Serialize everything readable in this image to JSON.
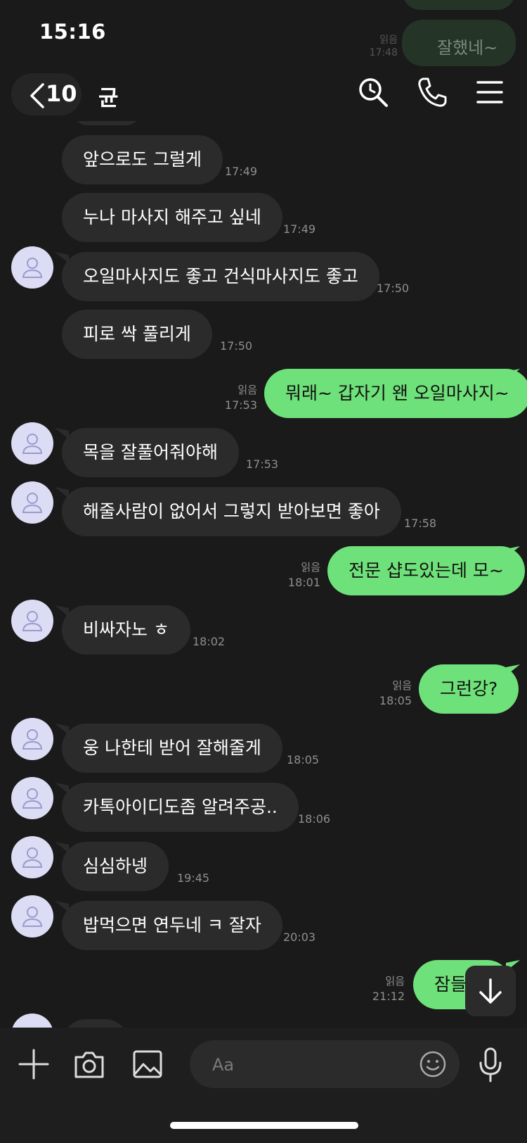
{
  "status_bar": {
    "time": "15:16"
  },
  "faded_top": {
    "read": "읽음",
    "time": "17:48",
    "text": "잘했네~"
  },
  "header": {
    "unread_count": "10",
    "title": "균"
  },
  "messages": [
    {
      "text": "앞으로도 그럴게",
      "time": "17:49"
    },
    {
      "text": "누나 마사지 해주고 싶네",
      "time": "17:49"
    },
    {
      "text": "오일마사지도 좋고 건식마사지도 좋고",
      "time": "17:50"
    },
    {
      "text": "피로 싹 풀리게",
      "time": "17:50"
    },
    {
      "text": "뭐래~ 갑자기 왠 오일마사지~",
      "time": "17:53",
      "read": "읽음"
    },
    {
      "text": "목을 잘풀어줘야해",
      "time": "17:53"
    },
    {
      "text": "해줄사람이 없어서 그렇지 받아보면 좋아",
      "time": "17:58"
    },
    {
      "text": "전문 샵도있는데 모~",
      "time": "18:01",
      "read": "읽음"
    },
    {
      "text": "비싸자노 ㅎ",
      "time": "18:02"
    },
    {
      "text": "그런강?",
      "time": "18:05",
      "read": "읽음"
    },
    {
      "text": "웅 나한테 받어 잘해줄게",
      "time": "18:05"
    },
    {
      "text": "카톡아이디도좀 알려주공..",
      "time": "18:06"
    },
    {
      "text": "심심하넹",
      "time": "19:45"
    },
    {
      "text": "밥먹으면 연두네 ㅋ 잘자",
      "time": "20:03"
    },
    {
      "text": "잠들",
      "time": "21:12",
      "read": "읽음"
    }
  ],
  "input": {
    "placeholder": "Aa"
  },
  "colors": {
    "outgoing_bubble": "#6fe17a",
    "incoming_bubble": "#2b2b2b",
    "background": "#1a1a1a"
  }
}
